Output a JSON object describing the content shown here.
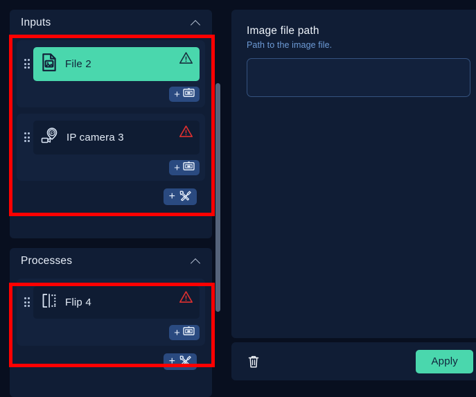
{
  "app": {
    "background": "#080f1f",
    "panel_color": "#101d35",
    "accent_green": "#4ad7ad",
    "accent_blue": "#2a4a80",
    "warning_red": "#e03030",
    "annotation_color": "#ff0000"
  },
  "pipeline": {
    "sections": [
      {
        "title": "Inputs",
        "collapse_icon": "chevron-up-icon",
        "nodes": [
          {
            "label": "File 2",
            "icon": "image-file-icon",
            "selected": true,
            "warning_icon": "warning-triangle-icon",
            "warning_color": "#17313f",
            "add_button": {
              "plus": "+",
              "icon": "camera-stream-icon"
            }
          },
          {
            "label": "IP camera 3",
            "icon": "ip-camera-pin-icon",
            "selected": false,
            "warning_icon": "warning-triangle-icon",
            "warning_color": "#e03030",
            "add_button": {
              "plus": "+",
              "icon": "camera-stream-icon"
            }
          }
        ],
        "footer_button": {
          "plus": "+",
          "icon": "tools-icon"
        }
      },
      {
        "title": "Processes",
        "collapse_icon": "chevron-up-icon",
        "nodes": [
          {
            "label": "Flip 4",
            "icon": "flip-icon",
            "selected": false,
            "warning_icon": "warning-triangle-icon",
            "warning_color": "#e03030",
            "add_button": {
              "plus": "+",
              "icon": "camera-stream-icon"
            }
          }
        ],
        "footer_button": {
          "plus": "+",
          "icon": "tools-icon"
        }
      }
    ]
  },
  "properties": {
    "title": "Image file path",
    "description": "Path to the image file.",
    "field_value": "",
    "field_placeholder": "",
    "delete_icon": "trash-icon",
    "apply_label": "Apply"
  },
  "annotations": [
    {
      "name": "inputs-highlight",
      "color": "#ff0000"
    },
    {
      "name": "processes-highlight",
      "color": "#ff0000"
    }
  ]
}
